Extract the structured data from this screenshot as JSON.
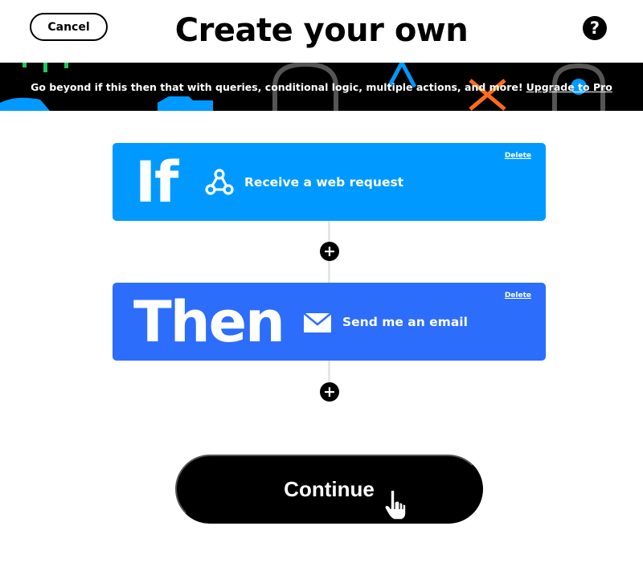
{
  "header": {
    "cancel_label": "Cancel",
    "title": "Create your own",
    "help_glyph": "?"
  },
  "banner": {
    "message": "Go beyond if this then that with queries, conditional logic, multiple actions, and more!",
    "upgrade_label": "Upgrade to Pro",
    "decoration_colors": [
      "#22c55e",
      "#0099ff",
      "#ff6b1a",
      "#555555"
    ]
  },
  "trigger": {
    "keyword": "If",
    "service_icon": "webhooks-icon",
    "service_label": "Receive a web request",
    "delete_label": "Delete",
    "color": "#0099ff"
  },
  "action": {
    "keyword": "Then",
    "service_icon": "email-icon",
    "service_label": "Send me an email",
    "delete_label": "Delete",
    "color": "#2c6dfb"
  },
  "add_step": {
    "glyph": "+"
  },
  "continue_label": "Continue"
}
